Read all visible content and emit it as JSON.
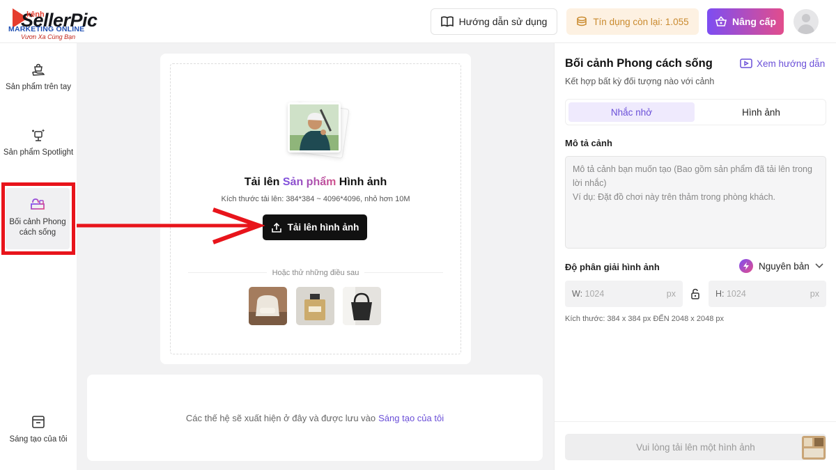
{
  "header": {
    "logo_word": "SellerPic",
    "logo_overlay": "kênh",
    "logo_sub": "MARKETING ONLINE",
    "logo_slogan": "Vươn Xa Cùng Bạn",
    "guide_label": "Hướng dẫn sử dụng",
    "credit_label": "Tín dụng còn lại: 1.055",
    "upgrade_label": "Nâng cấp"
  },
  "sidebar": {
    "items": [
      {
        "label": "Sản phẩm trên tay",
        "icon": "hand-bag-icon"
      },
      {
        "label": "Sản phẩm Spotlight",
        "icon": "spotlight-icon"
      },
      {
        "label": "Bối cảnh Phong cách sống",
        "icon": "lifestyle-icon",
        "active": true
      },
      {
        "label": "Sáng tạo của tôi",
        "icon": "archive-icon"
      }
    ]
  },
  "upload": {
    "title_pre": "Tải lên ",
    "title_hl1": "Sản phẩm",
    "title_post": " Hình ảnh",
    "size_note": "Kích thước tải lên: 384*384 ~ 4096*4096, nhỏ hơn 10M",
    "button_label": "Tải lên hình ảnh",
    "try_label": "Hoặc thử những điều sau",
    "samples": [
      "armchair",
      "perfume",
      "handbag"
    ]
  },
  "generation": {
    "note": "Các thế hệ sẽ xuất hiện ở đây và được lưu vào",
    "link": "Sáng tạo của tôi"
  },
  "panel": {
    "title": "Bối cảnh Phong cách sống",
    "guide_link": "Xem hướng dẫn",
    "subtitle": "Kết hợp bất kỳ đối tượng nào với cảnh",
    "tabs": [
      {
        "label": "Nhắc nhở",
        "active": true
      },
      {
        "label": "Hình ảnh",
        "active": false
      }
    ],
    "desc_label": "Mô tả cảnh",
    "desc_placeholder_1": "Mô tả cảnh bạn muốn tạo (Bao gồm sản phẩm đã tải lên trong lời nhắc)",
    "desc_placeholder_2": "Ví dụ: Đặt đồ chơi này trên thảm trong phòng khách.",
    "res_label": "Độ phân giải hình ảnh",
    "res_value": "Nguyên bản",
    "width": {
      "key": "W:",
      "value": "1024",
      "unit": "px"
    },
    "height": {
      "key": "H:",
      "value": "1024",
      "unit": "px"
    },
    "size_note": "Kích thước: 384 x 384 px ĐẾN 2048 x 2048 px",
    "generate_label": "Vui lòng tải lên một hình ảnh"
  },
  "colors": {
    "accent": "#6a4fd8",
    "annotation_red": "#e8141b",
    "credit_text": "#c98a2e"
  }
}
